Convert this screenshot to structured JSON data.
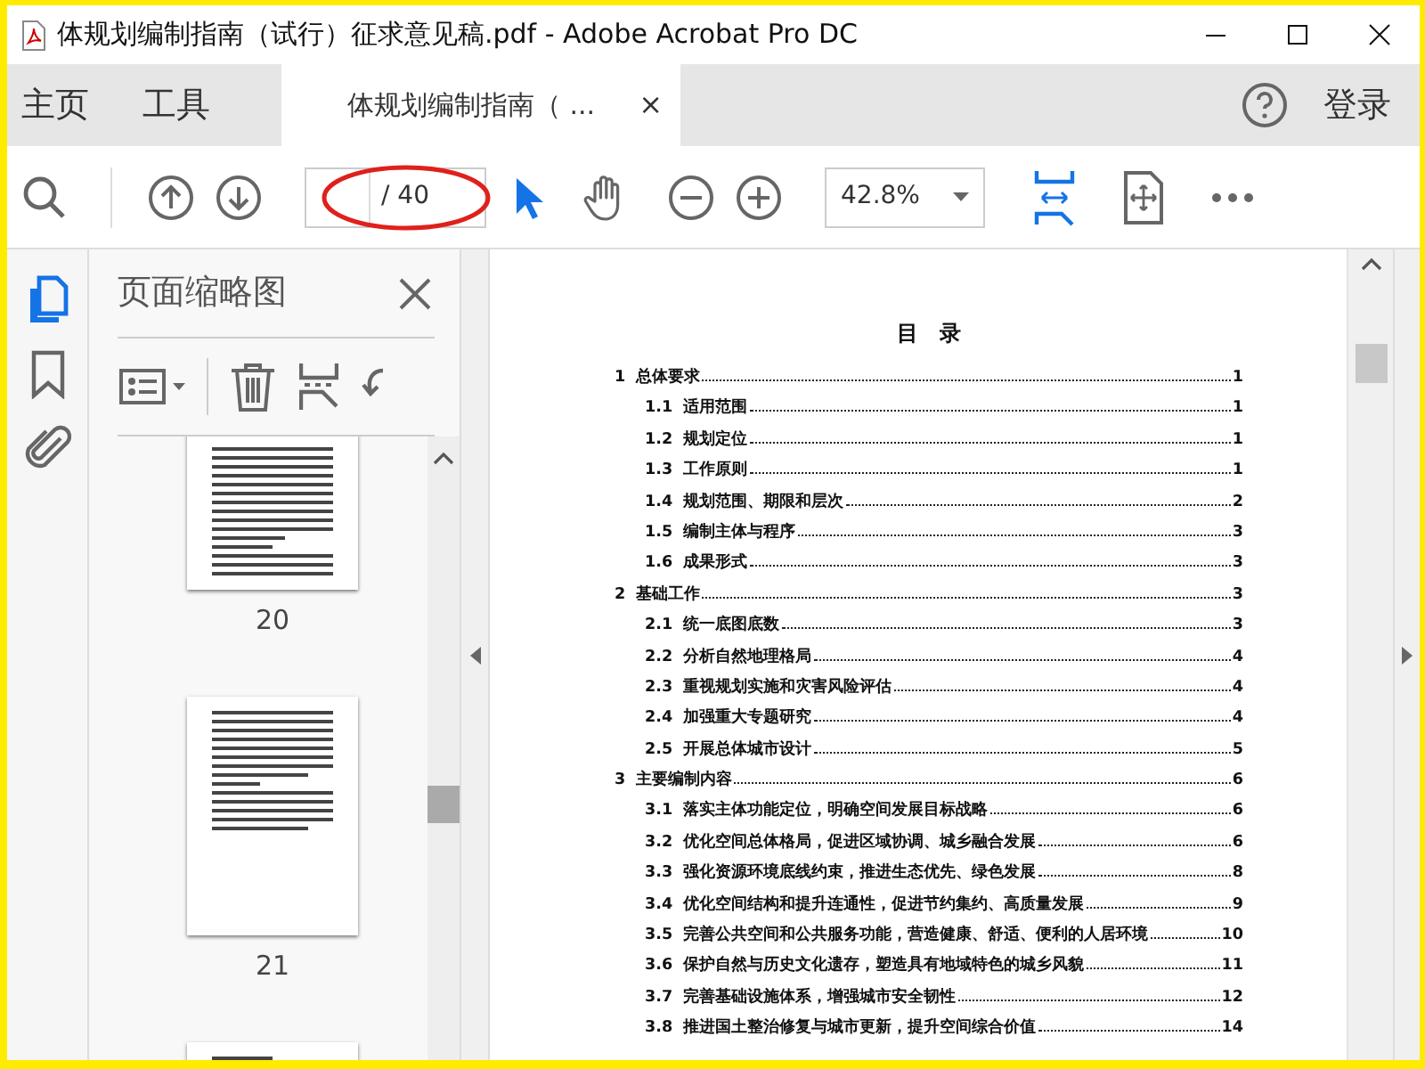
{
  "window": {
    "title": "体规划编制指南（试行）征求意见稿.pdf - Adobe Acrobat Pro DC"
  },
  "nav": [
    {
      "label": "主页",
      "selected": false
    },
    {
      "label": "工具",
      "selected": false
    }
  ],
  "document_tab": {
    "label": "体规划编制指南（ ...",
    "close": "×",
    "selected": true
  },
  "login": "登录",
  "toolbar": {
    "page_total": "/ 40",
    "zoom": "42.8%"
  },
  "thumbnails_panel": {
    "title": "页面缩略图",
    "pages": [
      {
        "label": "20",
        "cut_off": false
      },
      {
        "label": "21",
        "cut_off": false
      },
      {
        "cut_off": true
      }
    ]
  },
  "toc": {
    "title": "目　录",
    "entries": [
      {
        "number": "1",
        "title": "总体要求",
        "page": "1",
        "children": [
          {
            "number": "1.1",
            "title": "适用范围",
            "page": "1"
          },
          {
            "number": "1.2",
            "title": "规划定位",
            "page": "1"
          },
          {
            "number": "1.3",
            "title": "工作原则",
            "page": "1"
          },
          {
            "number": "1.4",
            "title": "规划范围、期限和层次",
            "page": "2"
          },
          {
            "number": "1.5",
            "title": "编制主体与程序",
            "page": "3"
          },
          {
            "number": "1.6",
            "title": "成果形式",
            "page": "3"
          }
        ]
      },
      {
        "number": "2",
        "title": "基础工作",
        "page": "3",
        "children": [
          {
            "number": "2.1",
            "title": "统一底图底数",
            "page": "3"
          },
          {
            "number": "2.2",
            "title": "分析自然地理格局",
            "page": "4"
          },
          {
            "number": "2.3",
            "title": "重视规划实施和灾害风险评估",
            "page": "4"
          },
          {
            "number": "2.4",
            "title": "加强重大专题研究",
            "page": "4"
          },
          {
            "number": "2.5",
            "title": "开展总体城市设计",
            "page": "5"
          }
        ]
      },
      {
        "number": "3",
        "title": "主要编制内容",
        "page": "6",
        "children": [
          {
            "number": "3.1",
            "title": "落实主体功能定位，明确空间发展目标战略",
            "page": "6"
          },
          {
            "number": "3.2",
            "title": "优化空间总体格局，促进区域协调、城乡融合发展",
            "page": "6"
          },
          {
            "number": "3.3",
            "title": "强化资源环境底线约束，推进生态优先、绿色发展",
            "page": "8"
          },
          {
            "number": "3.4",
            "title": "优化空间结构和提升连通性，促进节约集约、高质量发展",
            "page": "9"
          },
          {
            "number": "3.5",
            "title": "完善公共空间和公共服务功能，营造健康、舒适、便利的人居环境",
            "page": "10"
          },
          {
            "number": "3.6",
            "title": "保护自然与历史文化遗存，塑造具有地域特色的城乡风貌",
            "page": "11"
          },
          {
            "number": "3.7",
            "title": "完善基础设施体系，增强城市安全韧性",
            "page": "12"
          },
          {
            "number": "3.8",
            "title": "推进国土整治修复与城市更新，提升空间综合价值",
            "page": "14"
          }
        ]
      }
    ]
  }
}
